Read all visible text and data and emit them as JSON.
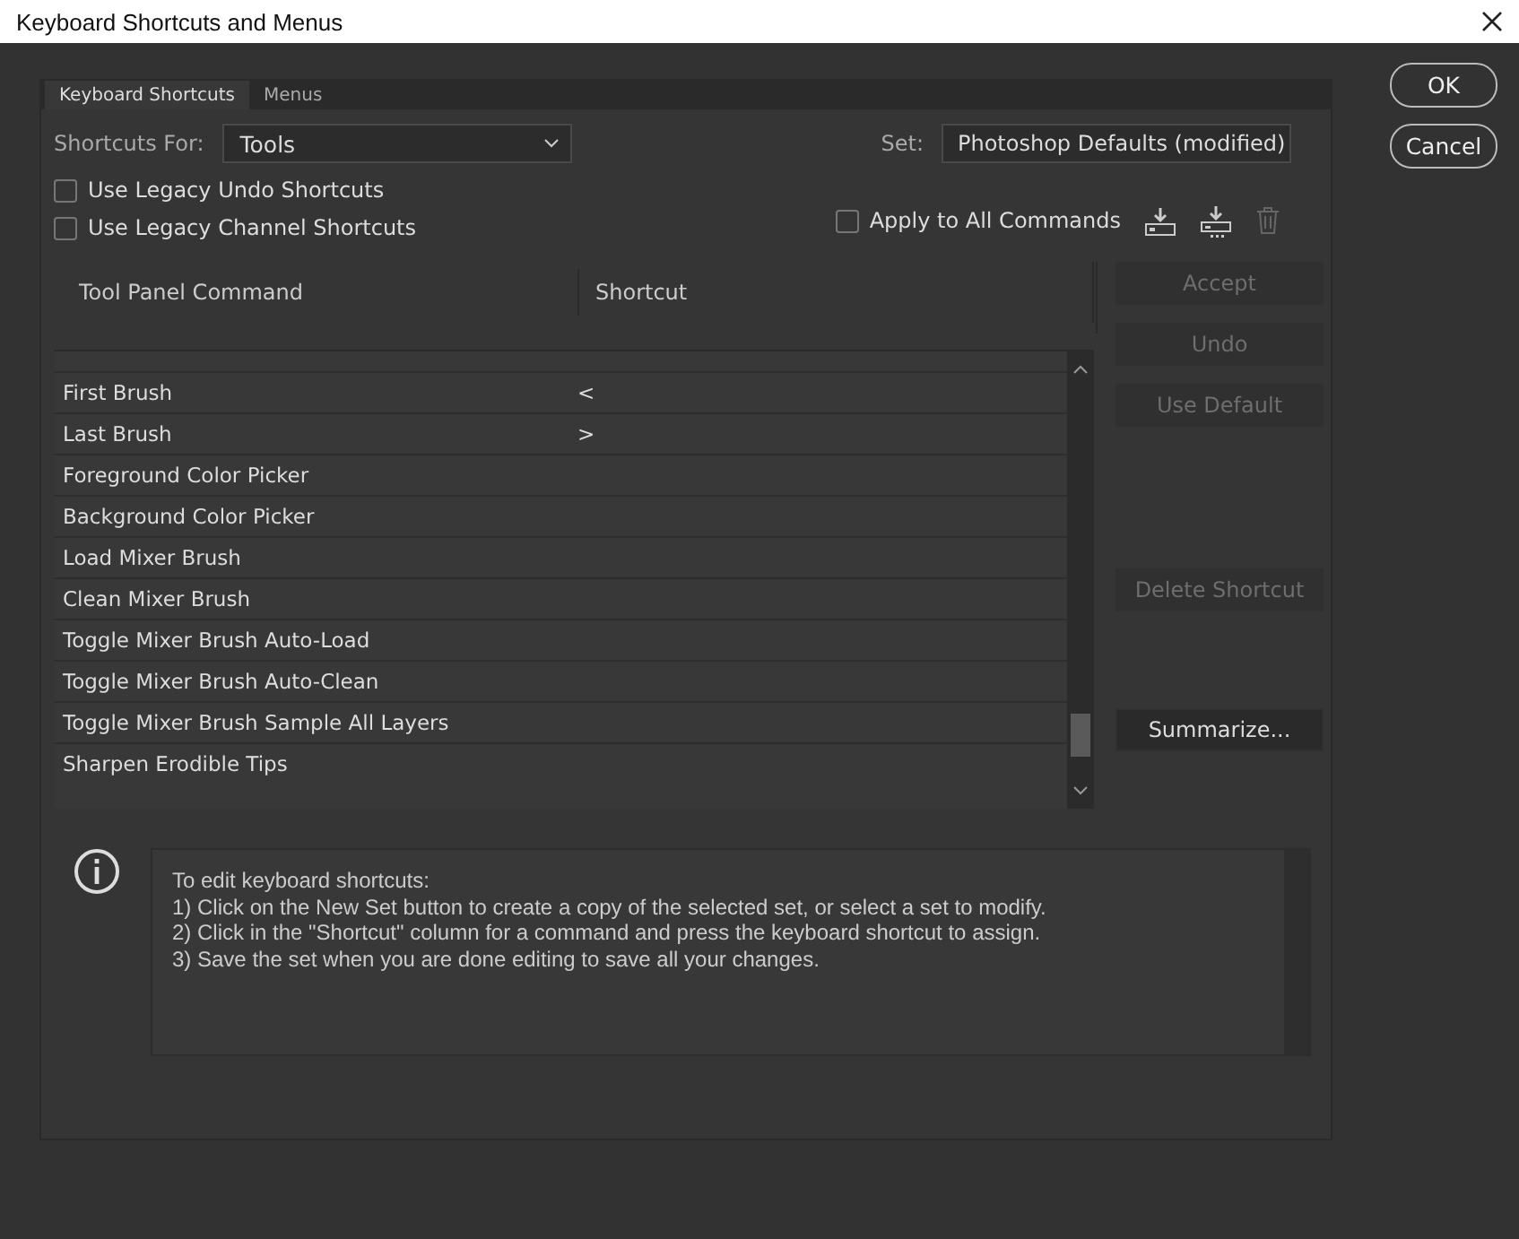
{
  "window": {
    "title": "Keyboard Shortcuts and Menus"
  },
  "tabs": [
    {
      "label": "Keyboard Shortcuts",
      "selected": true
    },
    {
      "label": "Menus",
      "selected": false
    }
  ],
  "shortcuts_for": {
    "label": "Shortcuts For:",
    "value": "Tools"
  },
  "set": {
    "label": "Set:",
    "value": "Photoshop Defaults (modified)"
  },
  "options": [
    {
      "label": "Use Legacy Undo Shortcuts",
      "checked": false
    },
    {
      "label": "Use Legacy Channel Shortcuts",
      "checked": false
    }
  ],
  "apply_all": {
    "label": "Apply to All Commands",
    "checked": false
  },
  "table": {
    "columns": [
      "Tool Panel Command",
      "Shortcut"
    ],
    "rows": [
      {
        "command": "First Brush",
        "shortcut": "<"
      },
      {
        "command": "Last Brush",
        "shortcut": ">"
      },
      {
        "command": "Foreground Color Picker",
        "shortcut": ""
      },
      {
        "command": "Background Color Picker",
        "shortcut": ""
      },
      {
        "command": "Load Mixer Brush",
        "shortcut": ""
      },
      {
        "command": "Clean Mixer Brush",
        "shortcut": ""
      },
      {
        "command": "Toggle Mixer Brush Auto-Load",
        "shortcut": ""
      },
      {
        "command": "Toggle Mixer Brush Auto-Clean",
        "shortcut": ""
      },
      {
        "command": "Toggle Mixer Brush Sample All Layers",
        "shortcut": ""
      },
      {
        "command": "Sharpen Erodible Tips",
        "shortcut": ""
      }
    ]
  },
  "side_buttons": [
    {
      "label": "Accept",
      "disabled": true
    },
    {
      "label": "Undo",
      "disabled": true
    },
    {
      "label": "Use Default",
      "disabled": true
    },
    {
      "label": "Delete Shortcut",
      "disabled": true
    },
    {
      "label": "Summarize...",
      "disabled": false
    }
  ],
  "dialog_buttons": [
    "OK",
    "Cancel"
  ],
  "info": {
    "lines": [
      "To edit keyboard shortcuts:",
      "1) Click on the New Set button to create a copy of the selected set, or select a set to modify.",
      "2) Click in the \"Shortcut\" column for a command and press the keyboard shortcut to assign.",
      "3) Save the set when you are done editing to save all your changes."
    ]
  }
}
